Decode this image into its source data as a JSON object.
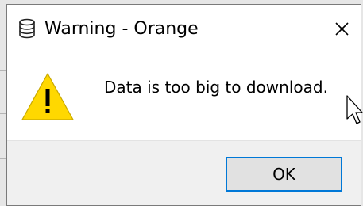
{
  "window": {
    "title": "Warning - Orange",
    "icon": "database-icon",
    "close_icon": "close-icon"
  },
  "content": {
    "icon": "warning-icon",
    "message": "Data is too big to download."
  },
  "buttons": {
    "ok_label": "OK"
  },
  "colors": {
    "accent": "#0078d7",
    "warning_fill": "#ffd800",
    "footer_bg": "#f0f0f0"
  }
}
